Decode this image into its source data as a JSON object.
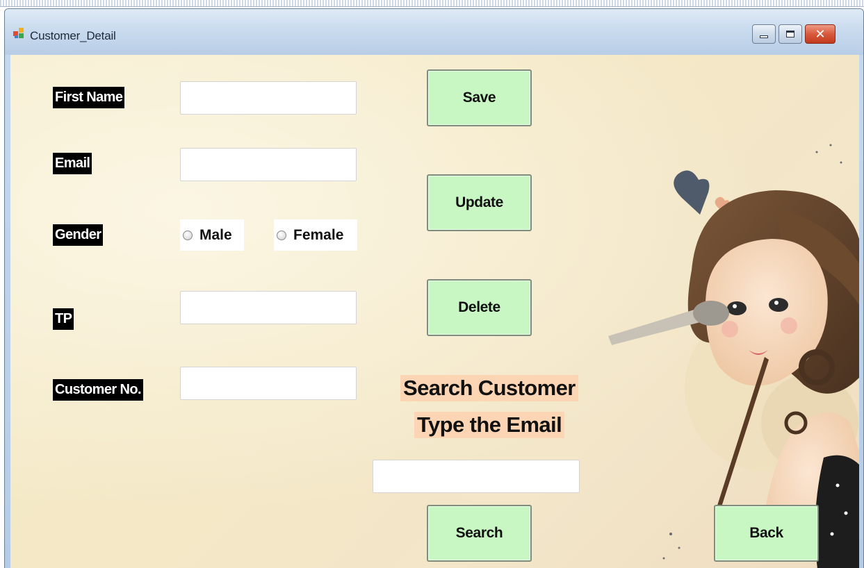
{
  "window": {
    "title": "Customer_Detail"
  },
  "form": {
    "first_name_label": "First Name",
    "first_name_value": "",
    "email_label": "Email",
    "email_value": "",
    "gender_label": "Gender",
    "gender_options": [
      "Male",
      "Female"
    ],
    "tp_label": "TP",
    "tp_value": "",
    "customer_no_label": "Customer No.",
    "customer_no_value": ""
  },
  "buttons": {
    "save": "Save",
    "update": "Update",
    "delete": "Delete",
    "search": "Search",
    "back": "Back"
  },
  "search": {
    "title_line1": "Search Customer",
    "title_line2": "Type the Email",
    "value": ""
  },
  "colors": {
    "button_bg": "#c8f7c4",
    "label_bg": "#000000",
    "search_title_bg": "#fcd5b4",
    "form_bg": "#f6edcc"
  },
  "icons": {
    "app": "app-icon",
    "minimize": "minimize-icon",
    "maximize": "maximize-icon",
    "close": "close-icon",
    "illustration": "girl-with-makeup-brush-illustration"
  }
}
